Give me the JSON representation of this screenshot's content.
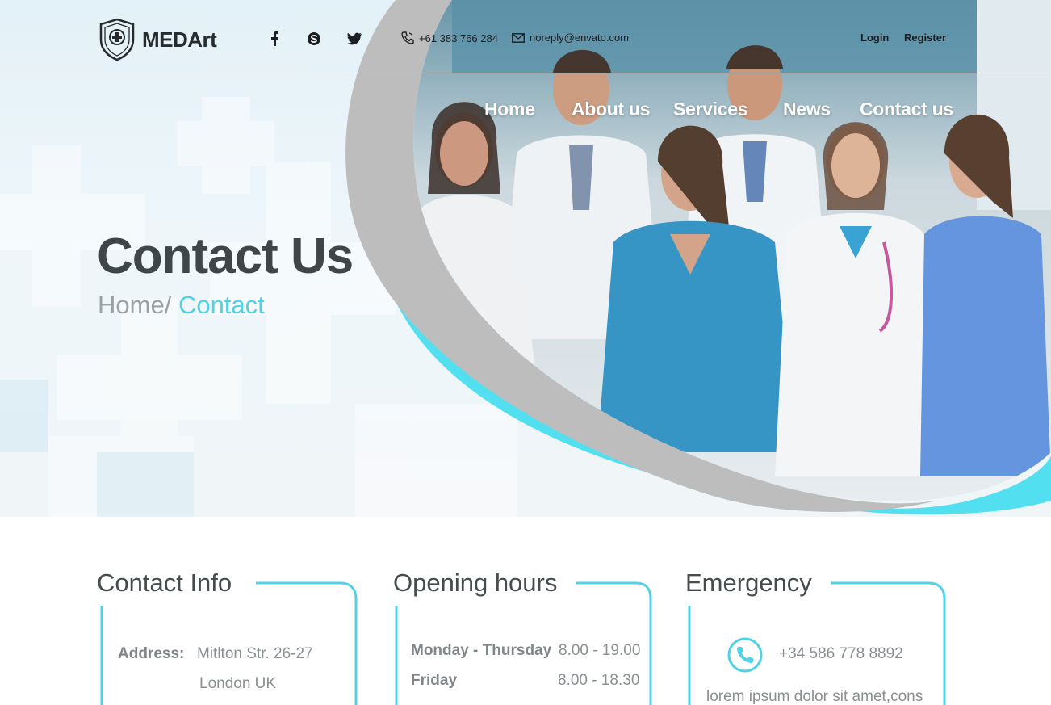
{
  "brand": {
    "name": "MEDArt"
  },
  "social": [
    {
      "icon": "facebook-icon"
    },
    {
      "icon": "skype-icon"
    },
    {
      "icon": "twitter-icon"
    }
  ],
  "topbar": {
    "phone": "+61 383 766 284",
    "email": "noreply@envato.com",
    "login": "Login",
    "register": "Register"
  },
  "nav": [
    "Home",
    "About us",
    "Services",
    "News",
    "Contact us"
  ],
  "hero": {
    "title": "Contact Us",
    "breadcrumb_home": "Home/",
    "breadcrumb_current": "Contact"
  },
  "contact_info": {
    "title": "Contact Info",
    "address_label": "Address:",
    "address_line1": "Mitlton Str. 26-27",
    "address_line2": "London UK"
  },
  "opening_hours": {
    "title": "Opening hours",
    "rows": [
      {
        "day": "Monday - Thursday",
        "time": "8.00 - 19.00"
      },
      {
        "day": "Friday",
        "time": "8.00 - 18.30"
      }
    ]
  },
  "emergency": {
    "title": "Emergency",
    "phone": "+34 586 778 8892",
    "text": "lorem ipsum dolor sit amet,cons"
  },
  "colors": {
    "accent": "#4fd1e6",
    "dark_text": "#3e4648",
    "muted_text": "#8a8f91",
    "swoosh_gray": "#bdbdbd"
  }
}
